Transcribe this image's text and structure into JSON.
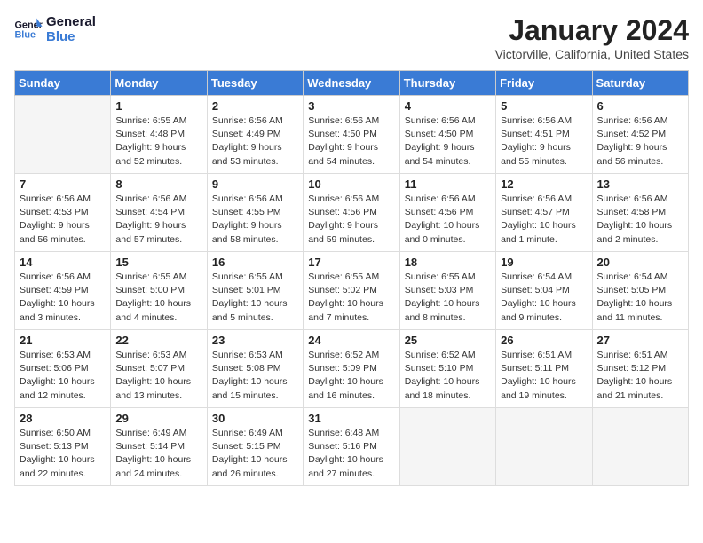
{
  "logo": {
    "line1": "General",
    "line2": "Blue"
  },
  "title": "January 2024",
  "location": "Victorville, California, United States",
  "days_of_week": [
    "Sunday",
    "Monday",
    "Tuesday",
    "Wednesday",
    "Thursday",
    "Friday",
    "Saturday"
  ],
  "weeks": [
    [
      {
        "num": "",
        "detail": ""
      },
      {
        "num": "1",
        "detail": "Sunrise: 6:55 AM\nSunset: 4:48 PM\nDaylight: 9 hours\nand 52 minutes."
      },
      {
        "num": "2",
        "detail": "Sunrise: 6:56 AM\nSunset: 4:49 PM\nDaylight: 9 hours\nand 53 minutes."
      },
      {
        "num": "3",
        "detail": "Sunrise: 6:56 AM\nSunset: 4:50 PM\nDaylight: 9 hours\nand 54 minutes."
      },
      {
        "num": "4",
        "detail": "Sunrise: 6:56 AM\nSunset: 4:50 PM\nDaylight: 9 hours\nand 54 minutes."
      },
      {
        "num": "5",
        "detail": "Sunrise: 6:56 AM\nSunset: 4:51 PM\nDaylight: 9 hours\nand 55 minutes."
      },
      {
        "num": "6",
        "detail": "Sunrise: 6:56 AM\nSunset: 4:52 PM\nDaylight: 9 hours\nand 56 minutes."
      }
    ],
    [
      {
        "num": "7",
        "detail": "Sunrise: 6:56 AM\nSunset: 4:53 PM\nDaylight: 9 hours\nand 56 minutes."
      },
      {
        "num": "8",
        "detail": "Sunrise: 6:56 AM\nSunset: 4:54 PM\nDaylight: 9 hours\nand 57 minutes."
      },
      {
        "num": "9",
        "detail": "Sunrise: 6:56 AM\nSunset: 4:55 PM\nDaylight: 9 hours\nand 58 minutes."
      },
      {
        "num": "10",
        "detail": "Sunrise: 6:56 AM\nSunset: 4:56 PM\nDaylight: 9 hours\nand 59 minutes."
      },
      {
        "num": "11",
        "detail": "Sunrise: 6:56 AM\nSunset: 4:56 PM\nDaylight: 10 hours\nand 0 minutes."
      },
      {
        "num": "12",
        "detail": "Sunrise: 6:56 AM\nSunset: 4:57 PM\nDaylight: 10 hours\nand 1 minute."
      },
      {
        "num": "13",
        "detail": "Sunrise: 6:56 AM\nSunset: 4:58 PM\nDaylight: 10 hours\nand 2 minutes."
      }
    ],
    [
      {
        "num": "14",
        "detail": "Sunrise: 6:56 AM\nSunset: 4:59 PM\nDaylight: 10 hours\nand 3 minutes."
      },
      {
        "num": "15",
        "detail": "Sunrise: 6:55 AM\nSunset: 5:00 PM\nDaylight: 10 hours\nand 4 minutes."
      },
      {
        "num": "16",
        "detail": "Sunrise: 6:55 AM\nSunset: 5:01 PM\nDaylight: 10 hours\nand 5 minutes."
      },
      {
        "num": "17",
        "detail": "Sunrise: 6:55 AM\nSunset: 5:02 PM\nDaylight: 10 hours\nand 7 minutes."
      },
      {
        "num": "18",
        "detail": "Sunrise: 6:55 AM\nSunset: 5:03 PM\nDaylight: 10 hours\nand 8 minutes."
      },
      {
        "num": "19",
        "detail": "Sunrise: 6:54 AM\nSunset: 5:04 PM\nDaylight: 10 hours\nand 9 minutes."
      },
      {
        "num": "20",
        "detail": "Sunrise: 6:54 AM\nSunset: 5:05 PM\nDaylight: 10 hours\nand 11 minutes."
      }
    ],
    [
      {
        "num": "21",
        "detail": "Sunrise: 6:53 AM\nSunset: 5:06 PM\nDaylight: 10 hours\nand 12 minutes."
      },
      {
        "num": "22",
        "detail": "Sunrise: 6:53 AM\nSunset: 5:07 PM\nDaylight: 10 hours\nand 13 minutes."
      },
      {
        "num": "23",
        "detail": "Sunrise: 6:53 AM\nSunset: 5:08 PM\nDaylight: 10 hours\nand 15 minutes."
      },
      {
        "num": "24",
        "detail": "Sunrise: 6:52 AM\nSunset: 5:09 PM\nDaylight: 10 hours\nand 16 minutes."
      },
      {
        "num": "25",
        "detail": "Sunrise: 6:52 AM\nSunset: 5:10 PM\nDaylight: 10 hours\nand 18 minutes."
      },
      {
        "num": "26",
        "detail": "Sunrise: 6:51 AM\nSunset: 5:11 PM\nDaylight: 10 hours\nand 19 minutes."
      },
      {
        "num": "27",
        "detail": "Sunrise: 6:51 AM\nSunset: 5:12 PM\nDaylight: 10 hours\nand 21 minutes."
      }
    ],
    [
      {
        "num": "28",
        "detail": "Sunrise: 6:50 AM\nSunset: 5:13 PM\nDaylight: 10 hours\nand 22 minutes."
      },
      {
        "num": "29",
        "detail": "Sunrise: 6:49 AM\nSunset: 5:14 PM\nDaylight: 10 hours\nand 24 minutes."
      },
      {
        "num": "30",
        "detail": "Sunrise: 6:49 AM\nSunset: 5:15 PM\nDaylight: 10 hours\nand 26 minutes."
      },
      {
        "num": "31",
        "detail": "Sunrise: 6:48 AM\nSunset: 5:16 PM\nDaylight: 10 hours\nand 27 minutes."
      },
      {
        "num": "",
        "detail": ""
      },
      {
        "num": "",
        "detail": ""
      },
      {
        "num": "",
        "detail": ""
      }
    ]
  ]
}
